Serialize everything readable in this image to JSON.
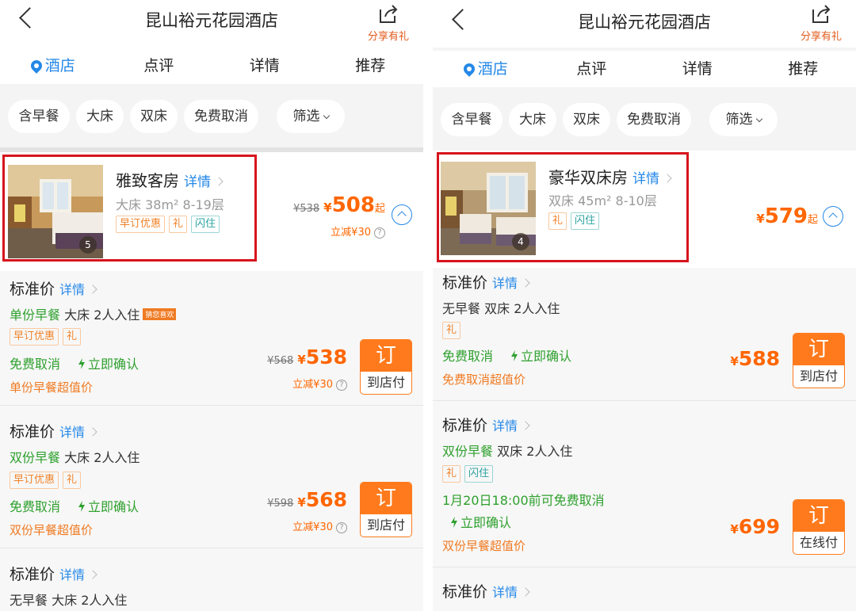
{
  "left": {
    "header": {
      "title": "昆山裕元花园酒店",
      "share_label": "分享有礼"
    },
    "tabs": [
      "酒店",
      "点评",
      "详情",
      "推荐"
    ],
    "filters": [
      "含早餐",
      "大床",
      "双床",
      "免费取消",
      "筛选"
    ],
    "room": {
      "name": "雅致客房",
      "detail": "详情",
      "spec": "大床 38m² 8-19层",
      "tags": [
        "早订优惠",
        "礼",
        "闪住"
      ],
      "photo_count": "5",
      "original_price": "¥538",
      "currency": "¥",
      "price": "508",
      "from": "起",
      "discount": "立减¥30"
    },
    "rates": [
      {
        "title": "标准价",
        "detail": "详情",
        "meal": "单份早餐",
        "bed": "大床 2人入住",
        "badge": "猜您喜欢",
        "tags": [
          "早订优惠",
          "礼"
        ],
        "cancel": "免费取消",
        "confirm": "立即确认",
        "value": "单份早餐超值价",
        "original_price": "¥568",
        "currency": "¥",
        "price": "538",
        "discount": "立减¥30",
        "book": "订",
        "pay": "到店付"
      },
      {
        "title": "标准价",
        "detail": "详情",
        "meal": "双份早餐",
        "bed": "大床 2人入住",
        "tags": [
          "早订优惠",
          "礼"
        ],
        "cancel": "免费取消",
        "confirm": "立即确认",
        "value": "双份早餐超值价",
        "original_price": "¥598",
        "currency": "¥",
        "price": "568",
        "discount": "立减¥30",
        "book": "订",
        "pay": "到店付"
      },
      {
        "title": "标准价",
        "detail": "详情",
        "meal": "无早餐",
        "bed": "大床 2人入住"
      }
    ]
  },
  "right": {
    "header": {
      "title": "昆山裕元花园酒店",
      "share_label": "分享有礼"
    },
    "tabs": [
      "酒店",
      "点评",
      "详情",
      "推荐"
    ],
    "filters": [
      "含早餐",
      "大床",
      "双床",
      "免费取消",
      "筛选"
    ],
    "room": {
      "name": "豪华双床房",
      "detail": "详情",
      "spec": "双床 45m² 8-10层",
      "tags": [
        "礼",
        "闪住"
      ],
      "photo_count": "4",
      "currency": "¥",
      "price": "579",
      "from": "起"
    },
    "rates": [
      {
        "title": "标准价",
        "detail": "详情",
        "meal": "无早餐",
        "bed": "双床 2人入住",
        "tags": [
          "礼"
        ],
        "cancel": "免费取消",
        "confirm": "立即确认",
        "value": "免费取消超值价",
        "currency": "¥",
        "price": "588",
        "book": "订",
        "pay": "到店付"
      },
      {
        "title": "标准价",
        "detail": "详情",
        "meal": "双份早餐",
        "bed": "双床 2人入住",
        "tags": [
          "礼",
          "闪住"
        ],
        "cancel": "1月20日18:00前可免费取消",
        "confirm": "立即确认",
        "value": "双份早餐超值价",
        "currency": "¥",
        "price": "699",
        "book": "订",
        "pay": "在线付"
      },
      {
        "title": "标准价",
        "detail": "详情"
      }
    ]
  },
  "colors": {
    "accent_blue": "#2588e8",
    "price_orange": "#ff6600",
    "book_orange": "#ff7a1c",
    "green": "#2ea02e",
    "highlight_red": "#d6141d"
  }
}
